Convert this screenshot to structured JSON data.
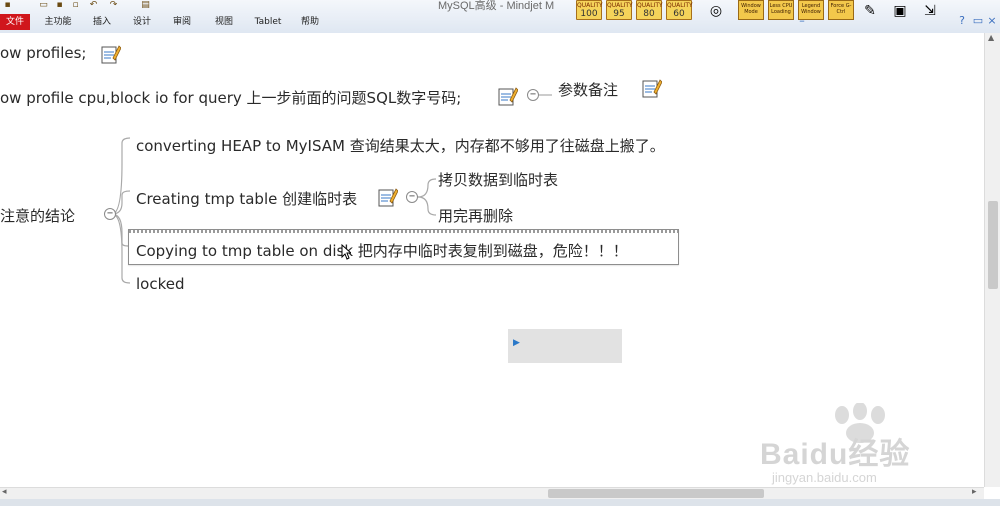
{
  "window": {
    "title": "MySQL高级 - Mindjet M"
  },
  "menu": {
    "tabs": [
      "文件",
      "主功能",
      "插入",
      "设计",
      "审阅",
      "视图",
      "Tablet",
      "帮助"
    ]
  },
  "quality_badges": [
    {
      "label": "QUALITY",
      "value": "100"
    },
    {
      "label": "QUALITY",
      "value": "95"
    },
    {
      "label": "QUALITY",
      "value": "80"
    },
    {
      "label": "QUALITY",
      "value": "60"
    }
  ],
  "tool_buttons": [
    {
      "label": "Window Mode"
    },
    {
      "label": "Less CPU Loading"
    },
    {
      "label": "Legend Window"
    },
    {
      "label": "Force G-Ctrl"
    }
  ],
  "mindmap": {
    "nodes": {
      "show_profiles": "ow profiles;",
      "show_profile_cpu": "ow profile cpu,block io for query 上一步前面的问题SQL数字号码;",
      "param_note": "参数备注",
      "conclusion": "注意的结论",
      "converting_heap": "converting HEAP to MyISAM 查询结果太大，内存都不够用了往磁盘上搬了。",
      "creating_tmp": "Creating tmp table 创建临时表",
      "copy_data": "拷贝数据到临时表",
      "delete_after": "用完再删除",
      "copying_disk": "Copying to tmp table on disk 把内存中临时表复制到磁盘，危险！！！",
      "locked": "locked"
    }
  },
  "watermark": {
    "brand": "Baidu经验",
    "url": "jingyan.baidu.com"
  },
  "colors": {
    "file_tab": "#d0161c",
    "branch_line": "#a9a9a9",
    "badge": "#f5d35a"
  }
}
